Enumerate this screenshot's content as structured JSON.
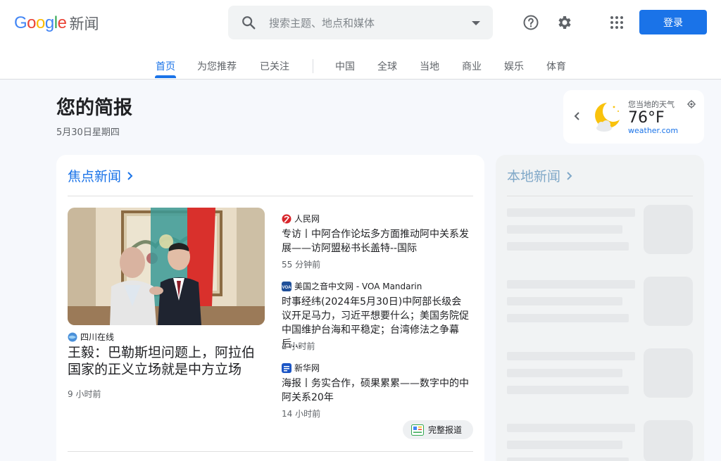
{
  "header": {
    "logo_letters": [
      "G",
      "o",
      "o",
      "g",
      "l",
      "e"
    ],
    "logo_colors": [
      "#4285F4",
      "#EA4335",
      "#FBBC05",
      "#4285F4",
      "#34A853",
      "#EA4335"
    ],
    "logo_suffix": "新闻",
    "search_placeholder": "搜索主题、地点和媒体",
    "login_label": "登录"
  },
  "nav": {
    "items": [
      "首页",
      "为您推荐",
      "已关注",
      "中国",
      "全球",
      "当地",
      "商业",
      "娱乐",
      "体育"
    ],
    "active_index": 0
  },
  "briefing": {
    "title": "您的简报",
    "date": "5月30日星期四"
  },
  "weather": {
    "label": "您当地的天气",
    "temp": "76°F",
    "source": "weather.com"
  },
  "top_stories": {
    "title": "焦点新闻",
    "main": {
      "source": "四川在线",
      "headline": "王毅：巴勒斯坦问题上，阿拉伯国家的正义立场就是中方立场",
      "time": "9 小时前"
    },
    "side": [
      {
        "source": "人民网",
        "headline": "专访丨中阿合作论坛多方面推动阿中关系发展——访阿盟秘书长盖特--国际",
        "time": "55 分钟前"
      },
      {
        "source": "美国之音中文网 - VOA Mandarin",
        "headline": "时事经纬(2024年5月30日)中阿部长级会议开足马力，习近平想要什么；美国务院促中国维护台海和平稳定；台湾修法之争幕后…",
        "time": "2 小时前"
      },
      {
        "source": "新华网",
        "headline": "海报丨务实合作，硕果累累——数字中的中阿关系20年",
        "time": "14 小时前"
      }
    ],
    "full_coverage": "完整报道"
  },
  "local_news": {
    "title": "本地新闻"
  }
}
